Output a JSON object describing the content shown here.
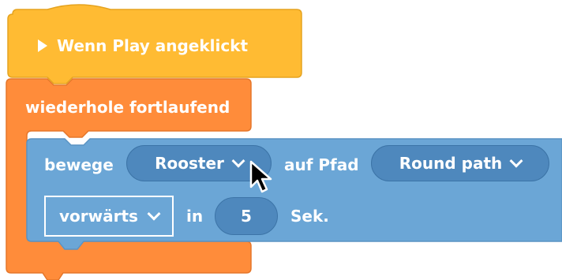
{
  "hat_block": {
    "label": "Wenn Play angeklickt",
    "icon": "play-icon",
    "color": "#ffbb33"
  },
  "forever_block": {
    "label": "wiederhole fortlaufend",
    "color": "#ff8c3a"
  },
  "motion_block": {
    "color": "#6ba6d6",
    "verb": "bewege",
    "character": "Rooster",
    "path_label": "auf Pfad",
    "path": "Round path",
    "direction": "vorwärts",
    "in_label": "in",
    "duration": "5",
    "unit": "Sek."
  }
}
